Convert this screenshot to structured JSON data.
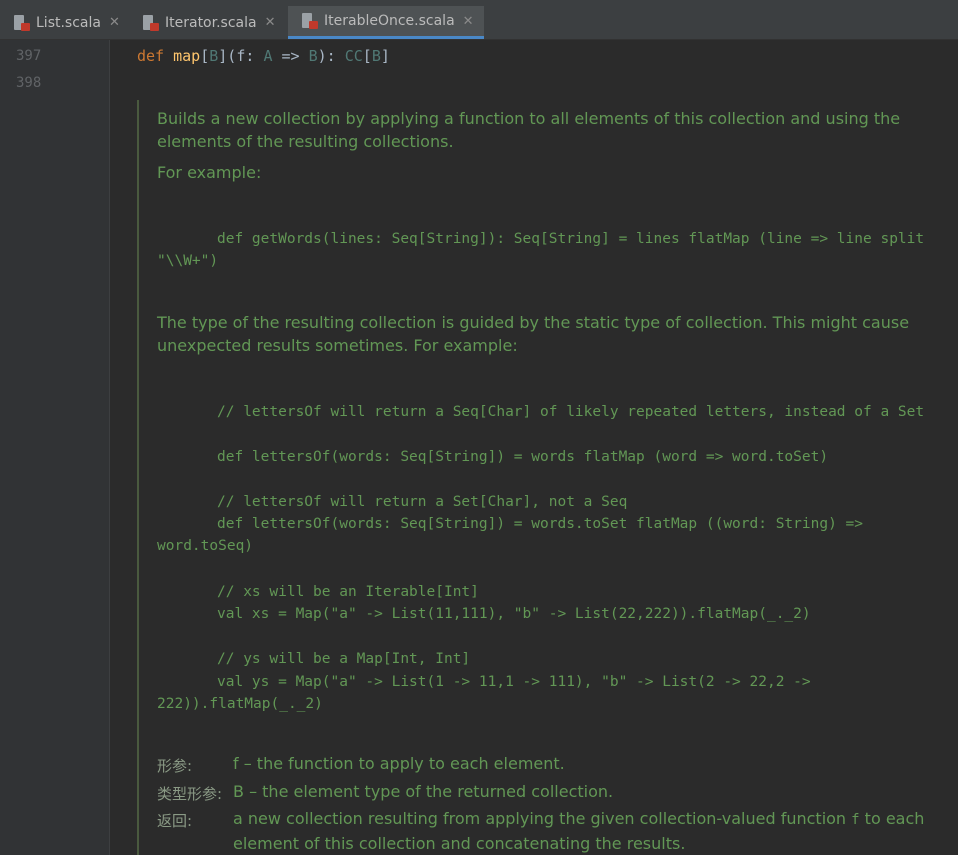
{
  "tabs": [
    {
      "label": "List.scala",
      "icon": "scala-file-icon",
      "active": false
    },
    {
      "label": "Iterator.scala",
      "icon": "scala-file-icon",
      "active": false
    },
    {
      "label": "IterableOnce.scala",
      "icon": "scala-file-icon",
      "active": true
    }
  ],
  "close_glyph": "✕",
  "gutter": {
    "line1": "397",
    "line2": "398"
  },
  "signature": {
    "kw": "def",
    "name": "map",
    "tparam_open": "[",
    "tparam": "B",
    "tparam_close": "](f: ",
    "a": "A",
    "arrow": " => ",
    "b": "B",
    "mid": "): ",
    "cc": "CC",
    "lb": "[",
    "rb": "B",
    "end": "]"
  },
  "doc": {
    "p1": "Builds a new collection by applying a function to all elements of this collection and using the elements of the resulting collections.",
    "p2": "For example:",
    "code1": "def getWords(lines: Seq[String]): Seq[String] = lines flatMap (line => line split \"\\\\W+\")",
    "p3": "The type of the resulting collection is guided by the static type of collection. This might cause unexpected results sometimes. For example:",
    "code2": "// lettersOf will return a Seq[Char] of likely repeated letters, instead of a Set",
    "code3": "def lettersOf(words: Seq[String]) = words flatMap (word => word.toSet)",
    "code4": "// lettersOf will return a Set[Char], not a Seq",
    "code5": "def lettersOf(words: Seq[String]) = words.toSet flatMap ((word: String) => word.toSeq)",
    "code6": "// xs will be an Iterable[Int]",
    "code7": "val xs = Map(\"a\" -> List(11,111), \"b\" -> List(22,222)).flatMap(_._2)",
    "code8": "// ys will be a Map[Int, Int]",
    "code9": "val ys = Map(\"a\" -> List(1 -> 11,1 -> 111), \"b\" -> List(2 -> 22,2 -> 222)).flatMap(_._2)",
    "params_label": "形参:",
    "params_value": "f – the function to apply to each element.",
    "tparams_label": "类型形参:",
    "tparams_value": "B – the element type of the returned collection.",
    "returns_label": "返回:",
    "returns_value_a": "a new collection resulting from applying the given collection-valued function ",
    "returns_value_f": "f",
    "returns_value_b": " to each element of this collection and concatenating the results."
  }
}
